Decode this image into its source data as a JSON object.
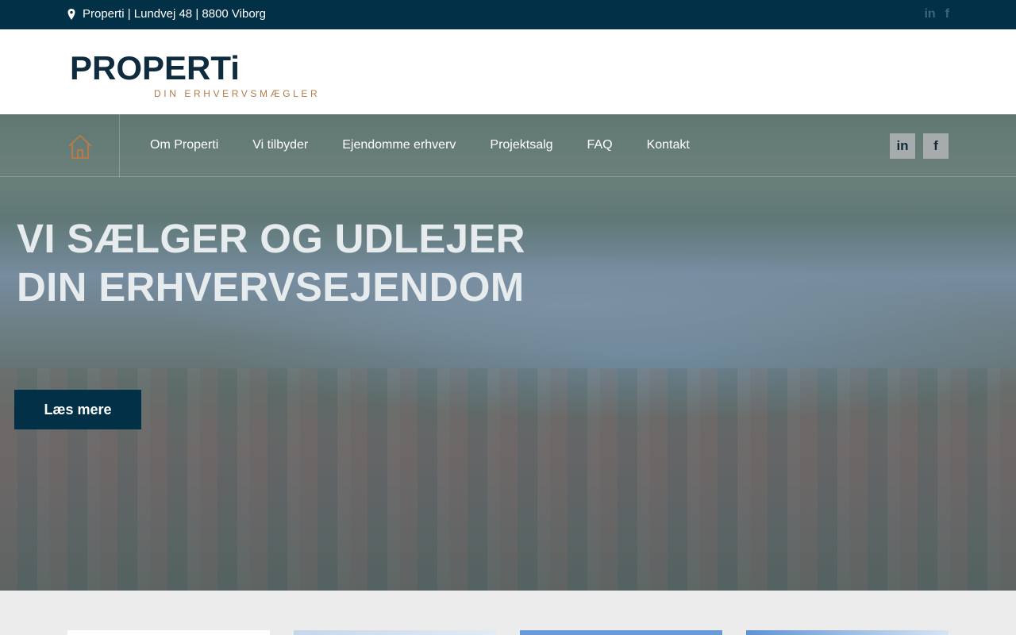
{
  "topbar": {
    "address": "Properti | Lundvej 48 | 8800 Viborg",
    "icons": [
      "map-pin-icon",
      "linkedin-icon",
      "facebook-icon"
    ],
    "background": "#023047"
  },
  "logo": {
    "wordmark": "PROPERTi",
    "tagline": "DIN ERHVERVSMÆGLER",
    "colors": {
      "wordmark": "#0f2c3f",
      "accent": "#b27c4a"
    }
  },
  "nav": {
    "home_icon": "home-icon",
    "items": [
      {
        "label": "Om Properti"
      },
      {
        "label": "Vi tilbyder"
      },
      {
        "label": "Ejendomme erhverv"
      },
      {
        "label": "Projektsalg"
      },
      {
        "label": "FAQ"
      },
      {
        "label": "Kontakt"
      }
    ],
    "social": [
      {
        "icon": "linkedin-icon",
        "glyph": "in"
      },
      {
        "icon": "facebook-icon",
        "glyph": "f"
      }
    ]
  },
  "hero": {
    "headline_line1": "VI SÆLGER OG UDLEJER",
    "headline_line2": "DIN ERHVERVSEJENDOM",
    "cta_label": "Læs mere",
    "cta_color": "#023047"
  }
}
